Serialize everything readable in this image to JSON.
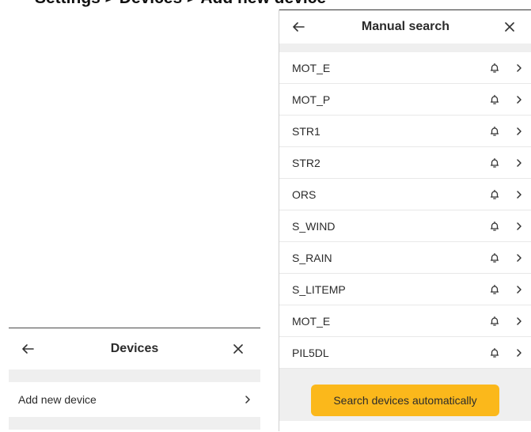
{
  "caption": "Settings > Devices > Add new device",
  "devices_screen": {
    "title": "Devices",
    "rows": [
      {
        "label": "Add new device"
      }
    ]
  },
  "manual_search_screen": {
    "title": "Manual search",
    "devices": [
      {
        "label": "MOT_E"
      },
      {
        "label": "MOT_P"
      },
      {
        "label": "STR1"
      },
      {
        "label": "STR2"
      },
      {
        "label": "ORS"
      },
      {
        "label": "S_WIND"
      },
      {
        "label": "S_RAIN"
      },
      {
        "label": "S_LITEMP"
      },
      {
        "label": "MOT_E"
      },
      {
        "label": "PIL5DL"
      }
    ],
    "auto_button_label": "Search devices automatically"
  },
  "colors": {
    "accent": "#fbb81b",
    "band": "#efefef"
  },
  "icons": {
    "back": "arrow-left-icon",
    "close": "close-icon",
    "bell": "bell-icon",
    "chevron": "chevron-right-icon"
  }
}
